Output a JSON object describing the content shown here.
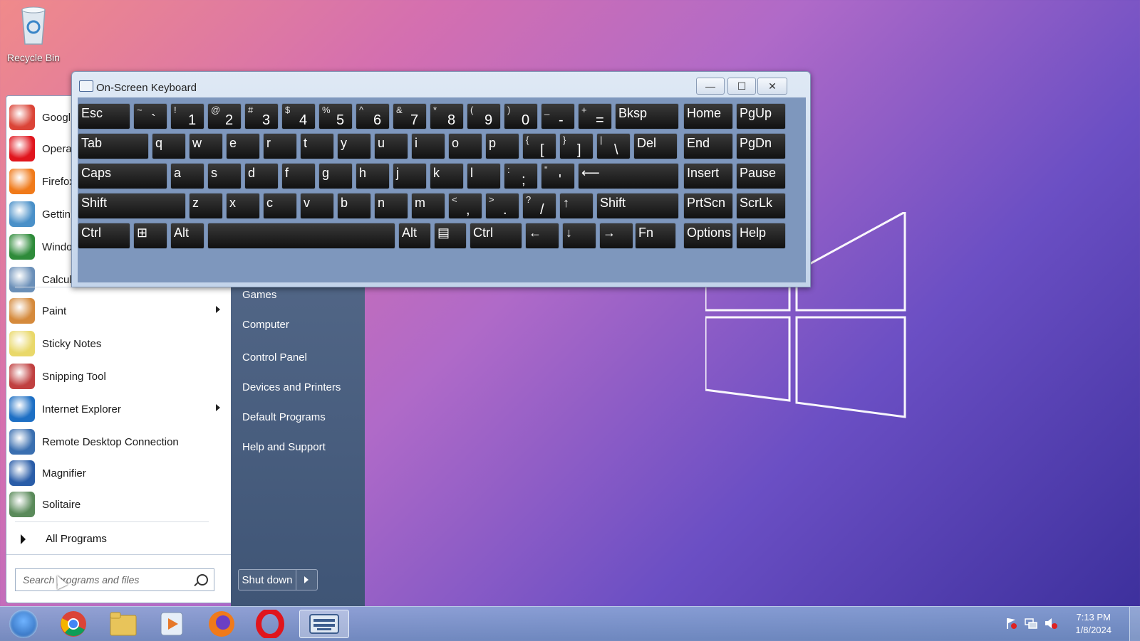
{
  "desktop": {
    "recycle_bin_label": "Recycle Bin"
  },
  "osk": {
    "title": "On-Screen Keyboard",
    "minimize": "—",
    "maximize": "☐",
    "close": "✕",
    "rows": [
      [
        {
          "label": "Esc"
        },
        {
          "top": "~",
          "bot": "`"
        },
        {
          "top": "!",
          "bot": "1"
        },
        {
          "top": "@",
          "bot": "2"
        },
        {
          "top": "#",
          "bot": "3"
        },
        {
          "top": "$",
          "bot": "4"
        },
        {
          "top": "%",
          "bot": "5"
        },
        {
          "top": "^",
          "bot": "6"
        },
        {
          "top": "&",
          "bot": "7"
        },
        {
          "top": "*",
          "bot": "8"
        },
        {
          "top": "(",
          "bot": "9"
        },
        {
          "top": ")",
          "bot": "0"
        },
        {
          "top": "_",
          "bot": "-"
        },
        {
          "top": "+",
          "bot": "="
        },
        {
          "label": "Bksp"
        },
        {
          "label": "Home"
        },
        {
          "label": "PgUp"
        }
      ],
      [
        {
          "label": "Tab"
        },
        {
          "label": "q"
        },
        {
          "label": "w"
        },
        {
          "label": "e"
        },
        {
          "label": "r"
        },
        {
          "label": "t"
        },
        {
          "label": "y"
        },
        {
          "label": "u"
        },
        {
          "label": "i"
        },
        {
          "label": "o"
        },
        {
          "label": "p"
        },
        {
          "top": "{",
          "bot": "["
        },
        {
          "top": "}",
          "bot": "]"
        },
        {
          "top": "|",
          "bot": "\\"
        },
        {
          "label": "Del"
        },
        {
          "label": "End"
        },
        {
          "label": "PgDn"
        }
      ],
      [
        {
          "label": "Caps"
        },
        {
          "label": "a"
        },
        {
          "label": "s"
        },
        {
          "label": "d"
        },
        {
          "label": "f"
        },
        {
          "label": "g"
        },
        {
          "label": "h"
        },
        {
          "label": "j"
        },
        {
          "label": "k"
        },
        {
          "label": "l"
        },
        {
          "top": ":",
          "bot": ";"
        },
        {
          "top": "\"",
          "bot": "'"
        },
        {
          "label": "⟵"
        },
        {
          "label": "Insert"
        },
        {
          "label": "Pause"
        }
      ],
      [
        {
          "label": "Shift"
        },
        {
          "label": "z"
        },
        {
          "label": "x"
        },
        {
          "label": "c"
        },
        {
          "label": "v"
        },
        {
          "label": "b"
        },
        {
          "label": "n"
        },
        {
          "label": "m"
        },
        {
          "top": "<",
          "bot": ","
        },
        {
          "top": ">",
          "bot": "."
        },
        {
          "top": "?",
          "bot": "/"
        },
        {
          "label": "↑"
        },
        {
          "label": "Shift"
        },
        {
          "label": "PrtScn"
        },
        {
          "label": "ScrLk"
        }
      ],
      [
        {
          "label": "Ctrl"
        },
        {
          "label": "⊞"
        },
        {
          "label": "Alt"
        },
        {
          "label": ""
        },
        {
          "label": "Alt"
        },
        {
          "label": "▤"
        },
        {
          "label": "Ctrl"
        },
        {
          "label": "←"
        },
        {
          "label": "↓"
        },
        {
          "label": "→"
        },
        {
          "label": "Fn"
        },
        {
          "label": "Options"
        },
        {
          "label": "Help"
        }
      ]
    ]
  },
  "start_menu": {
    "programs": [
      {
        "label": "Googl",
        "icon": "chrome-icon",
        "color": "#db4437"
      },
      {
        "label": "Opera",
        "icon": "opera-icon",
        "color": "#e0151d"
      },
      {
        "label": "Firefox",
        "icon": "firefox-icon",
        "color": "#f07a1a"
      },
      {
        "label": "Gettin",
        "icon": "getting-started-icon",
        "color": "#4a90c8"
      },
      {
        "label": "Windo",
        "icon": "windows-media-center-icon",
        "color": "#2e8b3a"
      },
      {
        "label": "Calculator",
        "icon": "calculator-icon",
        "color": "#6a8fb8"
      },
      {
        "label": "Paint",
        "icon": "paint-icon",
        "color": "#d58a3c",
        "submenu": true
      },
      {
        "label": "Sticky Notes",
        "icon": "sticky-notes-icon",
        "color": "#e9d86a"
      },
      {
        "label": "Snipping Tool",
        "icon": "snipping-tool-icon",
        "color": "#c04040"
      },
      {
        "label": "Internet Explorer",
        "icon": "internet-explorer-icon",
        "color": "#1d6fc4",
        "submenu": true
      },
      {
        "label": "Remote Desktop Connection",
        "icon": "remote-desktop-icon",
        "color": "#3a6fb0"
      },
      {
        "label": "Magnifier",
        "icon": "magnifier-icon",
        "color": "#2a5da8"
      },
      {
        "label": "Solitaire",
        "icon": "solitaire-icon",
        "color": "#5a8a5a"
      }
    ],
    "all_programs": "All Programs",
    "search_placeholder": "Search programs and files",
    "right_links": [
      "Games",
      "Computer",
      "Control Panel",
      "Devices and Printers",
      "Default Programs",
      "Help and Support"
    ],
    "shutdown_label": "Shut down"
  },
  "taskbar": {
    "items": [
      "start-orb",
      "chrome-icon",
      "explorer-folder-icon",
      "media-player-icon",
      "firefox-icon",
      "opera-icon",
      "on-screen-keyboard-icon"
    ],
    "time": "7:13 PM",
    "date": "1/8/2024"
  }
}
